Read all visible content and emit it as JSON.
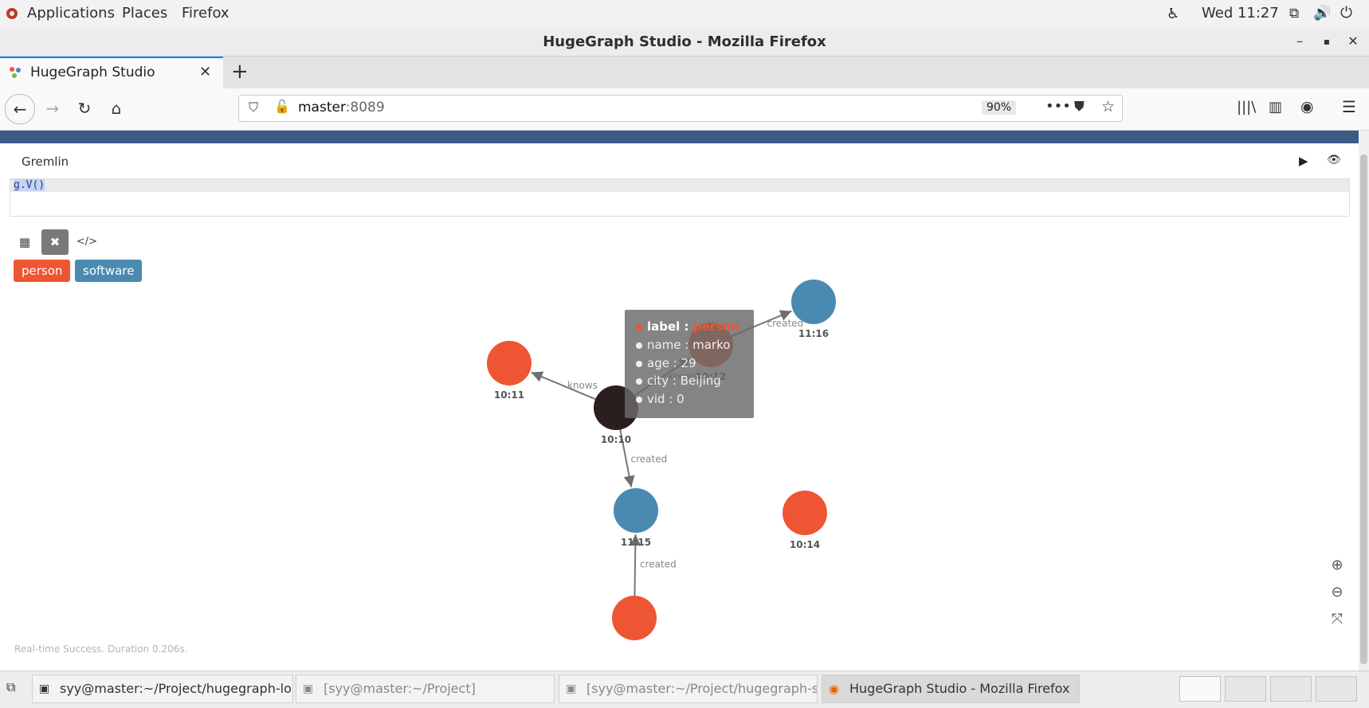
{
  "topbar": {
    "applications": "Applications",
    "places": "Places",
    "firefox": "Firefox",
    "clock": "Wed 11:27"
  },
  "window": {
    "title": "HugeGraph Studio - Mozilla Firefox"
  },
  "tab": {
    "label": "HugeGraph Studio"
  },
  "nav": {
    "url_host": "master",
    "url_port": ":8089",
    "zoom": "90%"
  },
  "studio": {
    "panel_title": "Gremlin",
    "query": "g.V()",
    "chips": [
      {
        "label": "person",
        "color": "#ee5533"
      },
      {
        "label": "software",
        "color": "#4a8ab0"
      }
    ],
    "status": "Real-time Success. Duration 0.206s."
  },
  "graph": {
    "nodes": [
      {
        "id": "10:10",
        "label": "10:10",
        "type": "selected",
        "color": "#2a1f1c"
      },
      {
        "id": "10:11",
        "label": "10:11",
        "type": "person",
        "color": "#ee5533"
      },
      {
        "id": "10:12",
        "label": "10:12",
        "type": "person",
        "color": "#ee5533"
      },
      {
        "id": "10:14",
        "label": "10:14",
        "type": "person",
        "color": "#ee5533"
      },
      {
        "id": "11:15",
        "label": "11:15",
        "type": "software",
        "color": "#4a8ab0"
      },
      {
        "id": "11:16",
        "label": "11:16",
        "type": "software",
        "color": "#4a8ab0"
      },
      {
        "id": "n-bottom",
        "label": "",
        "type": "person",
        "color": "#ee5533"
      }
    ],
    "edges": [
      {
        "from": "10:10",
        "to": "10:11",
        "label": "knows"
      },
      {
        "from": "10:10",
        "to": "10:12",
        "label": "knows"
      },
      {
        "from": "10:12",
        "to": "11:16",
        "label": "created"
      },
      {
        "from": "10:10",
        "to": "11:15",
        "label": "created"
      },
      {
        "from": "n-bottom",
        "to": "11:15",
        "label": "created"
      }
    ]
  },
  "tooltip": {
    "label_key": "label : ",
    "label_val": "person",
    "rows": [
      "name : marko",
      "age : 29",
      "city : Beijing",
      "vid : 0"
    ]
  },
  "taskbar": {
    "items": [
      "syy@master:~/Project/hugegraph-lo...",
      "[syy@master:~/Project]",
      "[syy@master:~/Project/hugegraph-st...",
      "HugeGraph Studio - Mozilla Firefox"
    ]
  }
}
